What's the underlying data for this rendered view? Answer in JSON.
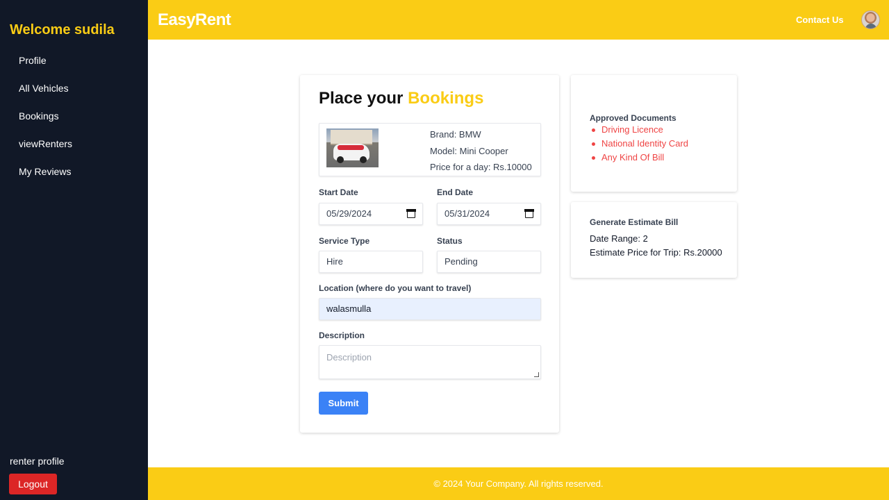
{
  "sidebar": {
    "welcome": "Welcome sudila",
    "items": [
      {
        "label": "Profile"
      },
      {
        "label": "All Vehicles"
      },
      {
        "label": "Bookings"
      },
      {
        "label": "viewRenters"
      },
      {
        "label": "My Reviews"
      }
    ],
    "profile_label": "renter profile",
    "logout_label": "Logout"
  },
  "header": {
    "brand": "EasyRent",
    "contact": "Contact Us"
  },
  "booking": {
    "title_prefix": "Place your",
    "title_highlight": "Bookings",
    "vehicle": {
      "brand": "Brand: BMW",
      "model": "Model: Mini Cooper",
      "price": "Price for a day: Rs.10000"
    },
    "start_date": {
      "label": "Start Date",
      "value": "05/29/2024"
    },
    "end_date": {
      "label": "End Date",
      "value": "05/31/2024"
    },
    "service_type": {
      "label": "Service Type",
      "value": "Hire"
    },
    "status": {
      "label": "Status",
      "value": "Pending"
    },
    "location": {
      "label": "Location (where do you want to travel)",
      "value": "walasmulla"
    },
    "description": {
      "label": "Description",
      "placeholder": "Description"
    },
    "submit_label": "Submit"
  },
  "documents": {
    "heading": "Approved Documents",
    "items": [
      "Driving Licence",
      "National Identity Card",
      "Any Kind Of Bill"
    ]
  },
  "estimate": {
    "heading": "Generate Estimate Bill",
    "date_range": "Date Range: 2",
    "estimate_price": "Estimate Price for Trip: Rs.20000"
  },
  "footer": {
    "text": "© 2024 Your Company. All rights reserved."
  },
  "colors": {
    "accent": "#facc15",
    "sidebar_bg": "#111827",
    "logout": "#dc2626",
    "submit": "#3b82f6",
    "doc_items": "#ef4444"
  }
}
